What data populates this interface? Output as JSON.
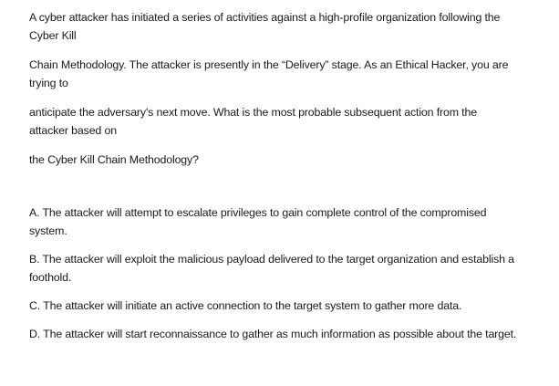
{
  "question": {
    "paragraphs": [
      [
        "A cyber attacker has initiated a series of activities against a high-profile organization following the",
        "Cyber Kill"
      ],
      [
        "Chain Methodology. The attacker is presently in the “Delivery” stage. As an Ethical Hacker, you are",
        "trying to"
      ],
      [
        "anticipate the adversary's next move. What is the most probable subsequent action from the",
        "attacker based on"
      ],
      [
        "the Cyber Kill Chain Methodology?"
      ]
    ]
  },
  "options": [
    [
      "A. The attacker will attempt to escalate privileges to gain complete control of the compromised",
      "system."
    ],
    [
      "B. The attacker will exploit the malicious payload delivered to the target organization and establish a",
      "foothold."
    ],
    [
      "C. The attacker will initiate an active connection to the target system to gather more data."
    ],
    [
      "D. The attacker will start reconnaissance to gather as much information as possible about the target."
    ]
  ]
}
